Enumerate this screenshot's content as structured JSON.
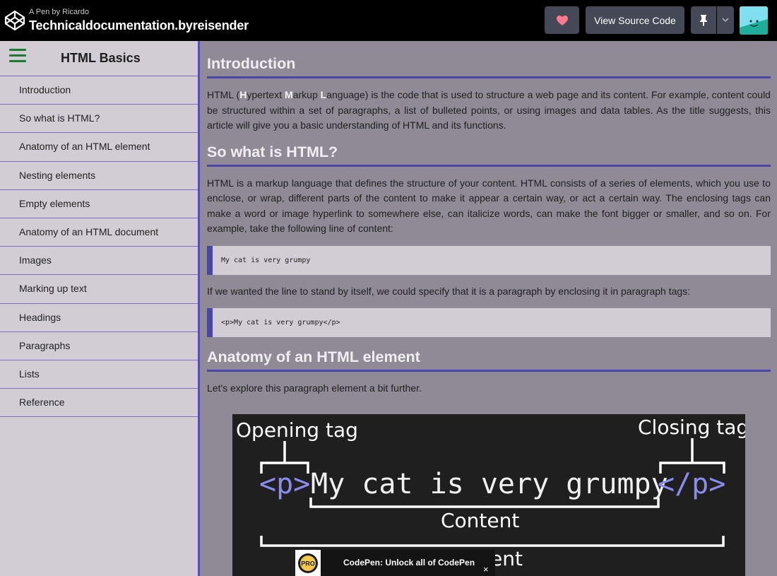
{
  "topbar": {
    "pen_by": "A Pen by Ricardo",
    "title": "Technicaldocumentation.byreisender",
    "view_source_label": "View Source Code",
    "icons": [
      "codepen-logo-icon",
      "heart-icon",
      "pin-icon",
      "chevron-down-icon",
      "avatar"
    ]
  },
  "sidebar": {
    "title": "HTML Basics",
    "items": [
      {
        "label": "Introduction"
      },
      {
        "label": "So what is HTML?"
      },
      {
        "label": "Anatomy of an HTML element"
      },
      {
        "label": "Nesting elements"
      },
      {
        "label": "Empty elements"
      },
      {
        "label": "Anatomy of an HTML document"
      },
      {
        "label": "Images"
      },
      {
        "label": "Marking up text"
      },
      {
        "label": "Headings"
      },
      {
        "label": "Paragraphs"
      },
      {
        "label": "Lists"
      },
      {
        "label": "Reference"
      }
    ]
  },
  "main": {
    "sections": [
      {
        "heading": "Introduction",
        "intro_parts": [
          "HTML (",
          "H",
          "ypertext ",
          "M",
          "arkup ",
          "L",
          "anguage) is the code that is used to structure a web page and its content. For example, content could be structured within a set of paragraphs, a list of bulleted points, or using images and data tables. As the title suggests, this article will give you a basic understanding of HTML and its functions."
        ]
      },
      {
        "heading": "So what is HTML?",
        "paragraph": "HTML is a markup language that defines the structure of your content. HTML consists of a series of elements, which you use to enclose, or wrap, different parts of the content to make it appear a certain way, or act a certain way. The enclosing tags can make a word or image hyperlink to somewhere else, can italicize words, can make the font bigger or smaller, and so on. For example, take the following line of content:",
        "code1": "My cat is very grumpy",
        "paragraph2": "If we wanted the line to stand by itself, we could specify that it is a paragraph by enclosing it in paragraph tags:",
        "code2": "<p>My cat is very grumpy</p>"
      },
      {
        "heading": "Anatomy of an HTML element",
        "paragraph": "Let's explore this paragraph element a bit further."
      }
    ],
    "diagram": {
      "opening_label": "Opening tag",
      "closing_label": "Closing tag",
      "open_tag": "<p>",
      "content_text": "My cat is very grumpy",
      "close_tag": "</p>",
      "content_label": "Content",
      "element_label": "Element"
    }
  },
  "promo": {
    "badge": "PRO",
    "text": "CodePen: Unlock all of CodePen",
    "close": "×"
  },
  "colors": {
    "accent": "#4c44ad",
    "tag": "#8a8cf0"
  }
}
